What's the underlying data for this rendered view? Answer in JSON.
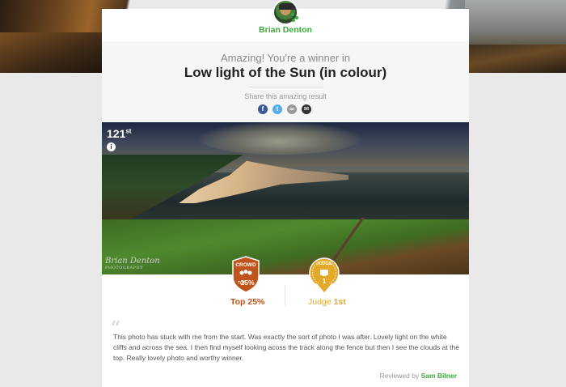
{
  "photographer": {
    "name": "Brian Denton"
  },
  "result": {
    "intro": "Amazing! You're a winner in",
    "category": "Low light of the Sun (in colour)"
  },
  "share": {
    "label": "Share this amazing result",
    "icons": [
      {
        "name": "facebook-icon",
        "glyph": "f",
        "color": "#3b5998"
      },
      {
        "name": "twitter-icon",
        "glyph": "t",
        "color": "#55acee"
      },
      {
        "name": "link-icon",
        "glyph": "∞",
        "color": "#9a9a9a"
      },
      {
        "name": "email-icon",
        "glyph": "✉",
        "color": "#333333"
      }
    ]
  },
  "photo": {
    "rank_number": "121",
    "rank_suffix": "st",
    "info_glyph": "i",
    "watermark_line1": "Brian Denton",
    "watermark_line2": "PHOTOGRAPHY"
  },
  "awards": {
    "crowd": {
      "badge_top": "CROWD",
      "badge_small": "TOP",
      "badge_value": "25%",
      "label": "Top 25%",
      "color": "#c0531c"
    },
    "judge": {
      "badge_top": "JUDGE",
      "badge_value": "1",
      "label_main": "Judge ",
      "label_bold": "1st",
      "color": "#e2a92a"
    }
  },
  "review": {
    "text": "This photo has stuck with me from the start. Was exactly the sort of photo I was after. Lovely light on the white cliffs and across the sea. I then find myself looking acoss the track along the fence but then I see the clouds at the top. Really lovely photo and worthy winner.",
    "by_prefix": "Reviewed by ",
    "reviewer": "Sam Bilner"
  }
}
